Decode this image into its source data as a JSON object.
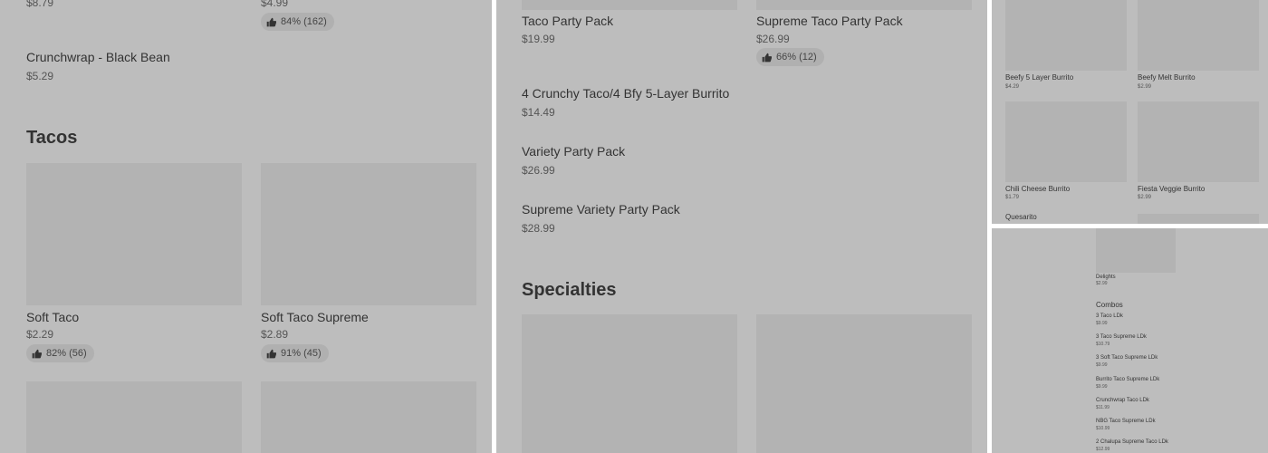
{
  "panel1": {
    "top_left_price": "$8.79",
    "top_right_price": "$4.99",
    "top_right_rating": "84% (162)",
    "crunchwrap_name": "Crunchwrap - Black Bean",
    "crunchwrap_price": "$5.29",
    "section_title": "Tacos",
    "items": [
      {
        "name": "Soft Taco",
        "price": "$2.29",
        "rating": "82% (56)"
      },
      {
        "name": "Soft Taco Supreme",
        "price": "$2.89",
        "rating": "91% (45)"
      }
    ]
  },
  "panel2": {
    "grid_items": [
      {
        "name": "Taco Party Pack",
        "price": "$19.99"
      },
      {
        "name": "Supreme Taco Party Pack",
        "price": "$26.99",
        "rating": "66% (12)"
      }
    ],
    "list_items": [
      {
        "name": "4 Crunchy Taco/4 Bfy 5-Layer Burrito",
        "price": "$14.49"
      },
      {
        "name": "Variety Party Pack",
        "price": "$26.99"
      },
      {
        "name": "Supreme Variety Party Pack",
        "price": "$28.99"
      }
    ],
    "section_title": "Specialties"
  },
  "panel3": {
    "items": [
      {
        "name": "Beefy 5 Layer Burrito",
        "price": "$4.29"
      },
      {
        "name": "Beefy Melt Burrito",
        "price": "$2.99"
      },
      {
        "name": "Chili Cheese Burrito",
        "price": "$1.79"
      },
      {
        "name": "Fiesta Veggie Burrito",
        "price": "$2.99"
      }
    ],
    "partial_item": "Quesarito"
  },
  "panel4": {
    "top_item_name": "Delights",
    "top_item_price": "$2.99",
    "section_title": "Combos",
    "items": [
      {
        "name": "3 Taco LDk",
        "price": "$9.99"
      },
      {
        "name": "3 Taco Supreme LDk",
        "price": "$10.79"
      },
      {
        "name": "3 Soft Taco Supreme LDk",
        "price": "$9.99"
      },
      {
        "name": "Burrito Taco Supreme LDk",
        "price": "$9.99"
      },
      {
        "name": "Crunchwrap Taco LDk",
        "price": "$11.99"
      },
      {
        "name": "NBG Taco Supreme LDk",
        "price": "$10.99"
      },
      {
        "name": "2 Chalupa Supreme Taco LDk",
        "price": "$12.99"
      }
    ]
  },
  "icons": {
    "rating": "thumbs-up-icon"
  }
}
